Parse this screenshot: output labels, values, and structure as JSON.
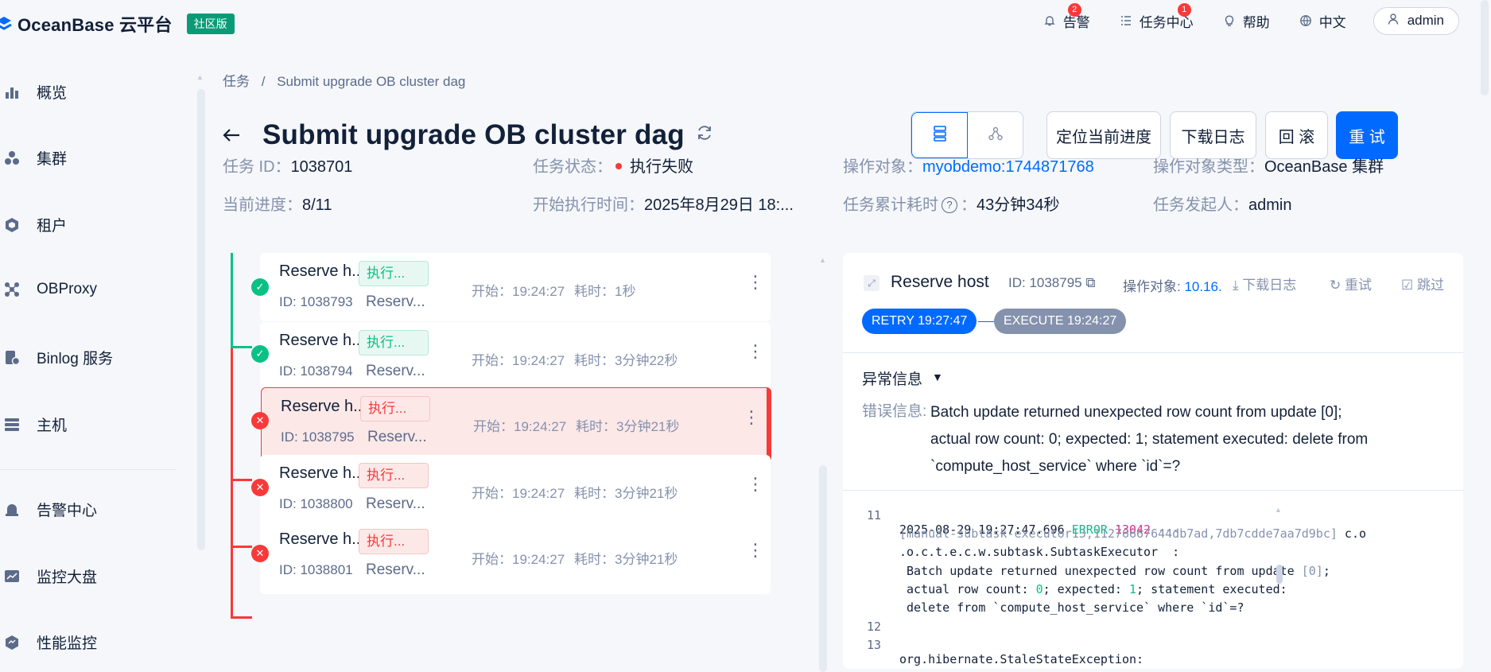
{
  "header": {
    "logo_text": "OceanBase 云平台",
    "edition": "社区版",
    "nav": [
      {
        "label": "告警",
        "icon": "bell-icon",
        "badge": "2"
      },
      {
        "label": "任务中心",
        "icon": "list-icon",
        "badge": "1"
      },
      {
        "label": "帮助",
        "icon": "bulb-icon",
        "badge": ""
      },
      {
        "label": "中文",
        "icon": "globe-icon",
        "badge": ""
      }
    ],
    "user": "admin"
  },
  "sidebar": {
    "items": [
      {
        "label": "概览",
        "icon": "bar-chart-icon"
      },
      {
        "label": "集群",
        "icon": "cluster-icon"
      },
      {
        "label": "租户",
        "icon": "tenant-icon"
      },
      {
        "label": "OBProxy",
        "icon": "proxy-icon"
      },
      {
        "label": "Binlog 服务",
        "icon": "binlog-icon"
      },
      {
        "label": "主机",
        "icon": "host-icon"
      },
      {
        "label": "告警中心",
        "icon": "alarm-icon"
      },
      {
        "label": "监控大盘",
        "icon": "monitor-icon"
      },
      {
        "label": "性能监控",
        "icon": "performance-icon"
      }
    ]
  },
  "breadcrumb": {
    "root": "任务",
    "sep": "/",
    "current": "Submit upgrade OB cluster dag"
  },
  "page": {
    "title": "Submit upgrade OB cluster dag",
    "buttons": {
      "locate": "定位当前进度",
      "download": "下载日志",
      "rollback": "回 滚",
      "retry": "重 试"
    }
  },
  "task_info": {
    "id_label": "任务 ID：",
    "id_value": "1038701",
    "status_label": "任务状态：",
    "status_value": "执行失败",
    "status_color": "#f93939",
    "target_label": "操作对象：",
    "target_value": "myobdemo:1744871768",
    "target_type_label": "操作对象类型：",
    "target_type_value": "OceanBase 集群",
    "progress_label": "当前进度：",
    "progress_value": "8/11",
    "start_label": "开始执行时间：",
    "start_value": "2025年8月29日 18:...",
    "elapsed_label": "任务累计耗时",
    "elapsed_value": "43分钟34秒",
    "creator_label": "任务发起人：",
    "creator_value": "admin"
  },
  "subtasks": [
    {
      "name": "Reserve h...",
      "tag": "执行...",
      "status": "success",
      "id": "ID: 1038793",
      "desc": "Reserv...",
      "start": "开始：19:24:27",
      "duration": "耗时：1秒"
    },
    {
      "name": "Reserve h...",
      "tag": "执行...",
      "status": "success",
      "id": "ID: 1038794",
      "desc": "Reserv...",
      "start": "开始：19:24:27",
      "duration": "耗时：3分钟22秒"
    },
    {
      "name": "Reserve h...",
      "tag": "执行...",
      "status": "failed",
      "id": "ID: 1038795",
      "desc": "Reserv...",
      "start": "开始：19:24:27",
      "duration": "耗时：3分钟21秒"
    },
    {
      "name": "Reserve h...",
      "tag": "执行...",
      "status": "failed",
      "id": "ID: 1038800",
      "desc": "Reserv...",
      "start": "开始：19:24:27",
      "duration": "耗时：3分钟21秒"
    },
    {
      "name": "Reserve h...",
      "tag": "执行...",
      "status": "failed",
      "id": "ID: 1038801",
      "desc": "Reserv...",
      "start": "开始：19:24:27",
      "duration": "耗时：3分钟21秒"
    }
  ],
  "detail": {
    "title": "Reserve host",
    "id": "ID: 1038795",
    "target_label": "操作对象:",
    "target_value": "10.16.",
    "actions": {
      "download": "下载日志",
      "retry": "重试",
      "skip": "跳过"
    },
    "retry_pill": "RETRY 19:27:47",
    "execute_pill": "EXECUTE 19:24:27",
    "exception_title": "异常信息",
    "error_label": "错误信息:",
    "error_lines": [
      "Batch update returned unexpected row count from update [0];",
      "actual row count: 0; expected: 1; statement executed: delete from",
      "`compute_host_service` where `id`=?"
    ]
  },
  "log": {
    "line11_no": "11",
    "line11_ts": "2025-08-29 19:27:47.696",
    "line11_level": "ERROR",
    "line11_pid": "13042",
    "line11_dash": "---",
    "line11_thread": "[manual-subtask-executor13,11276667644db7ad,7db7cdde7aa7d9bc]",
    "line11_co": "c.o",
    "line11_class": ".o.c.t.e.c.w.subtask.SubtaskExecutor  :",
    "line11_msg1_a": " Batch update returned unexpected row count from update ",
    "line11_msg1_b": "[0]",
    "line11_msg1_c": ";",
    "line11_msg2_a": " actual row count: ",
    "line11_msg2_b": "0",
    "line11_msg2_c": "; expected: ",
    "line11_msg2_d": "1",
    "line11_msg2_e": "; statement executed:",
    "line11_msg3": " delete from `compute_host_service` where `id`=?",
    "line12_no": "12",
    "line13_no": "13",
    "line13_text": "org.hibernate.StaleStateException:"
  }
}
